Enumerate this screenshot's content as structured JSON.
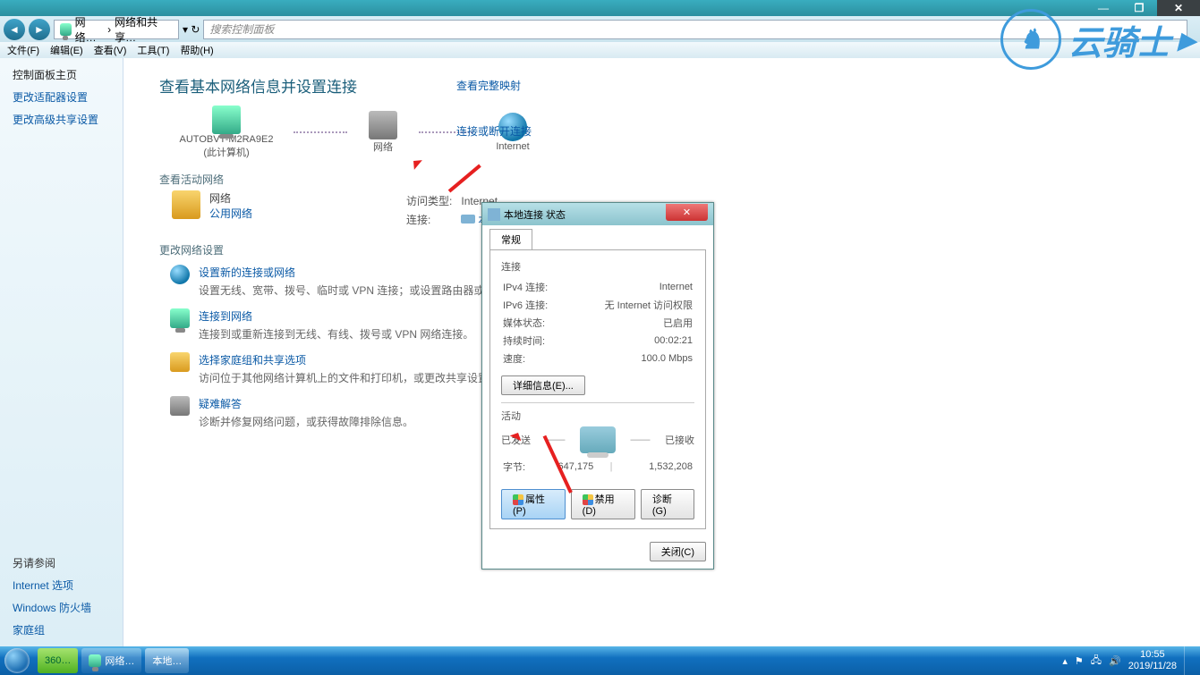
{
  "titlebar": {
    "minimize": "—",
    "maximize": "❐",
    "close": "✕"
  },
  "explorer": {
    "back": "◄",
    "fwd": "►",
    "breadcrumb1": "网络…",
    "breadcrumb2": "网络和共享…",
    "search_placeholder": "搜索控制面板"
  },
  "menubar": {
    "file": "文件(F)",
    "edit": "编辑(E)",
    "view": "查看(V)",
    "tool": "工具(T)",
    "help": "帮助(H)"
  },
  "sidebar": {
    "home": "控制面板主页",
    "adapter": "更改适配器设置",
    "adv_share": "更改高级共享设置",
    "see_also": "另请参阅",
    "internet_opts": "Internet 选项",
    "firewall": "Windows 防火墙",
    "homegroup": "家庭组"
  },
  "content": {
    "heading": "查看基本网络信息并设置连接",
    "node_pc": "AUTOBVT-M2RA9E2",
    "node_pc_sub": "(此计算机)",
    "node_net": "网络",
    "node_internet": "Internet",
    "map_link": "查看完整映射",
    "active_label": "查看活动网络",
    "diag_link": "连接或断开连接",
    "net_name": "网络",
    "net_type": "公用网络",
    "access_label": "访问类型:",
    "access_val": "Internet",
    "conn_label": "连接:",
    "conn_val": "本地连接",
    "change_label": "更改网络设置",
    "settings": [
      {
        "title": "设置新的连接或网络",
        "desc": "设置无线、宽带、拨号、临时或 VPN 连接；或设置路由器或访问点。"
      },
      {
        "title": "连接到网络",
        "desc": "连接到或重新连接到无线、有线、拨号或 VPN 网络连接。"
      },
      {
        "title": "选择家庭组和共享选项",
        "desc": "访问位于其他网络计算机上的文件和打印机，或更改共享设置。"
      },
      {
        "title": "疑难解答",
        "desc": "诊断并修复网络问题，或获得故障排除信息。"
      }
    ]
  },
  "dialog": {
    "title": "本地连接 状态",
    "tab": "常规",
    "conn_section": "连接",
    "ipv4_l": "IPv4 连接:",
    "ipv4_v": "Internet",
    "ipv6_l": "IPv6 连接:",
    "ipv6_v": "无 Internet 访问权限",
    "media_l": "媒体状态:",
    "media_v": "已启用",
    "dur_l": "持续时间:",
    "dur_v": "00:02:21",
    "speed_l": "速度:",
    "speed_v": "100.0 Mbps",
    "details_btn": "详细信息(E)...",
    "activity_section": "活动",
    "sent": "已发送",
    "recv": "已接收",
    "bytes_l": "字节:",
    "sent_v": "647,175",
    "recv_v": "1,532,208",
    "props_btn": "属性(P)",
    "disable_btn": "禁用(D)",
    "diag_btn": "诊断(G)",
    "close_btn": "关闭(C)",
    "x": "✕"
  },
  "taskbar": {
    "t360": "360…",
    "net": "网络…",
    "local": "本地…",
    "time": "10:55",
    "date": "2019/11/28"
  },
  "watermark": {
    "text": "云骑士",
    "suffix": "▸"
  }
}
